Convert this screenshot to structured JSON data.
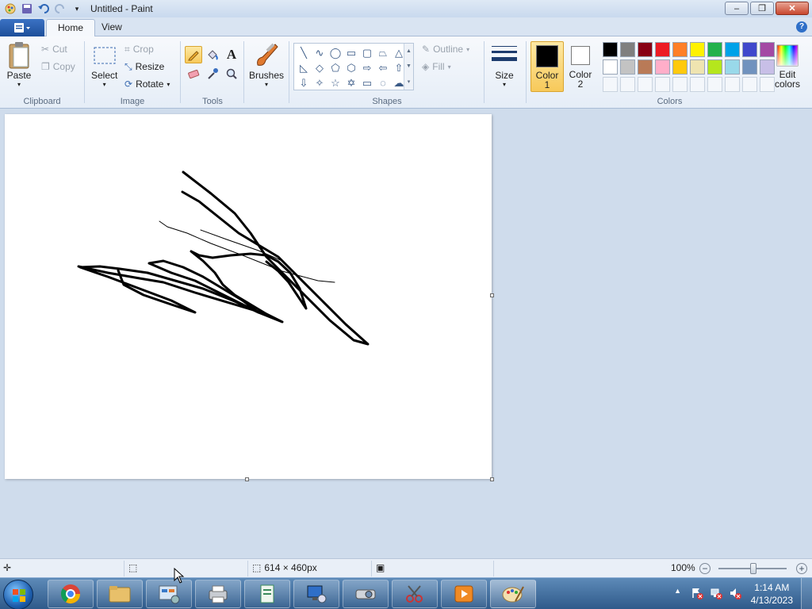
{
  "window": {
    "title": "Untitled - Paint",
    "controls": {
      "minimize": "–",
      "maximize": "❐",
      "close": "✕"
    }
  },
  "tabs": [
    {
      "label": "Home",
      "active": true
    },
    {
      "label": "View",
      "active": false
    }
  ],
  "ribbon": {
    "clipboard": {
      "group_label": "Clipboard",
      "paste": "Paste",
      "cut": "Cut",
      "copy": "Copy"
    },
    "image": {
      "group_label": "Image",
      "select": "Select",
      "crop": "Crop",
      "resize": "Resize",
      "rotate": "Rotate"
    },
    "tools": {
      "group_label": "Tools",
      "active_tool": "pencil"
    },
    "brushes": {
      "label": "Brushes"
    },
    "shapes": {
      "group_label": "Shapes",
      "outline": "Outline",
      "fill": "Fill"
    },
    "size": {
      "label": "Size"
    },
    "colors": {
      "group_label": "Colors",
      "color1_label_line1": "Color",
      "color1_label_line2": "1",
      "color2_label_line1": "Color",
      "color2_label_line2": "2",
      "color1": "#000000",
      "color2": "#ffffff",
      "edit_colors_line1": "Edit",
      "edit_colors_line2": "colors",
      "palette": [
        "#000000",
        "#7f7f7f",
        "#880015",
        "#ed1c24",
        "#ff7f27",
        "#fff200",
        "#22b14c",
        "#00a2e8",
        "#3f48cc",
        "#a349a4",
        "#ffffff",
        "#c3c3c3",
        "#b97a57",
        "#ffaec9",
        "#ffc90e",
        "#efe4b0",
        "#b5e61d",
        "#99d9ea",
        "#7092be",
        "#c8bfe7",
        "",
        "",
        "",
        "",
        "",
        "",
        "",
        "",
        "",
        ""
      ]
    }
  },
  "statusbar": {
    "canvas_size": "614 × 460px",
    "zoom": "100%"
  },
  "taskbar": {
    "time": "1:14 AM",
    "date": "4/13/2023"
  }
}
